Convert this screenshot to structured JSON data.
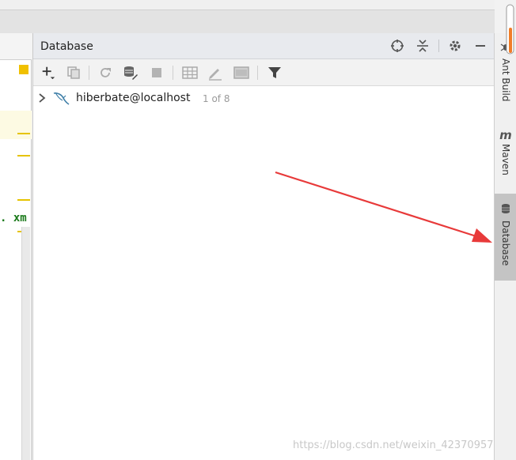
{
  "panel": {
    "title": "Database"
  },
  "header_icons": [
    "crosshair-icon",
    "collapse-icon",
    "gear-icon",
    "minimize-icon"
  ],
  "toolbar_icons": [
    "add-icon",
    "duplicate-icon",
    "refresh-icon",
    "edit-datasource-icon",
    "stop-icon",
    "table-icon",
    "pencil-icon",
    "console-icon",
    "filter-icon"
  ],
  "tree": {
    "datasource_name": "hiberbate@localhost",
    "datasource_count": "1 of 8"
  },
  "editor": {
    "code_fragment": ". xm"
  },
  "side_tabs": {
    "ant_build": "Ant Build",
    "maven": "Maven",
    "database": "Database",
    "maven_glyph": "m"
  },
  "watermark": "https://blog.csdn.net/weixin_42370957",
  "colors": {
    "accent_arrow": "#e83a3a",
    "selected_tab": "#c4c4c4",
    "scroll_thumb": "#f07d28"
  }
}
